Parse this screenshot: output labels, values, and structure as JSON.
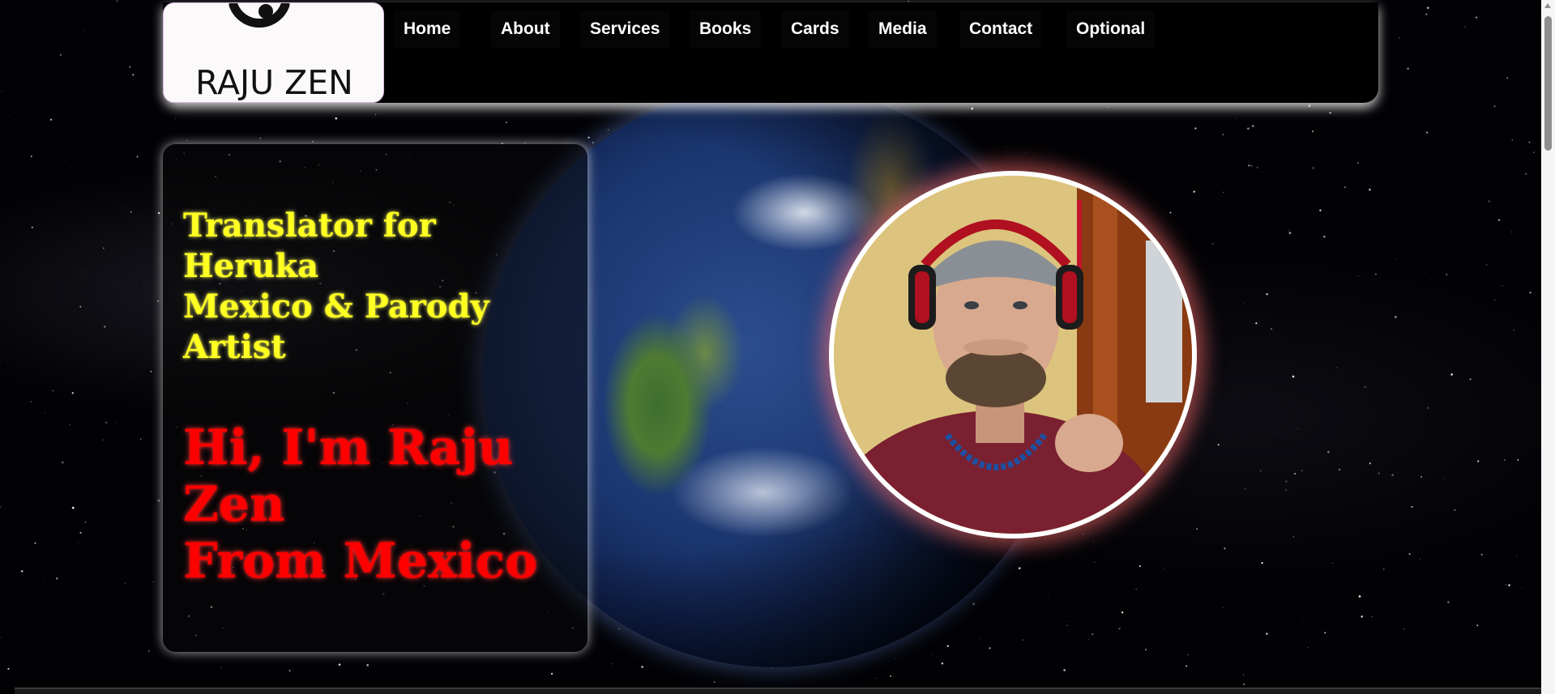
{
  "brand": {
    "name": "RAJU ZEN"
  },
  "nav": {
    "items": [
      {
        "label": "Home"
      },
      {
        "label": "About"
      },
      {
        "label": "Services"
      },
      {
        "label": "Books"
      },
      {
        "label": "Cards"
      },
      {
        "label": "Media"
      },
      {
        "label": "Contact"
      },
      {
        "label": "Optional"
      }
    ]
  },
  "hero": {
    "subtitle_lines": [
      "Translator for",
      "Heruka",
      "Mexico & Parody",
      "Artist"
    ],
    "headline_lines": [
      "Hi, I'm Raju",
      "Zen",
      "From Mexico"
    ]
  },
  "colors": {
    "subtitle": "#ffff22",
    "headline": "#ff0000",
    "photo_glow": "#ff6e6e",
    "header_bg": "#000000"
  }
}
